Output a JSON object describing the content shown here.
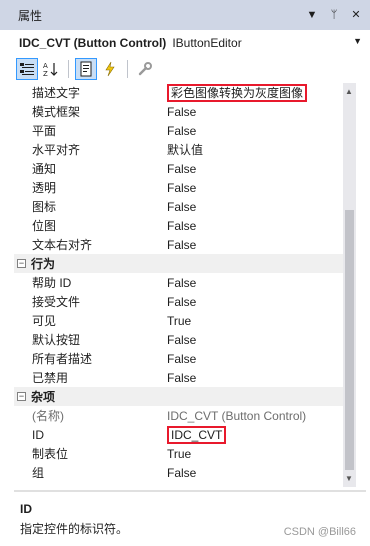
{
  "window": {
    "title": "属性",
    "buttons": [
      "▼",
      "ᛘ",
      "✕"
    ]
  },
  "object_selector": {
    "name": "IDC_CVT (Button Control)",
    "type": "IButtonEditor"
  },
  "rows": [
    {
      "kind": "prop",
      "name": "描述文字",
      "value": "彩色图像转换为灰度图像",
      "highlight": true
    },
    {
      "kind": "prop",
      "name": "模式框架",
      "value": "False"
    },
    {
      "kind": "prop",
      "name": "平面",
      "value": "False"
    },
    {
      "kind": "prop",
      "name": "水平对齐",
      "value": "默认值"
    },
    {
      "kind": "prop",
      "name": "通知",
      "value": "False"
    },
    {
      "kind": "prop",
      "name": "透明",
      "value": "False"
    },
    {
      "kind": "prop",
      "name": "图标",
      "value": "False"
    },
    {
      "kind": "prop",
      "name": "位图",
      "value": "False"
    },
    {
      "kind": "prop",
      "name": "文本右对齐",
      "value": "False"
    },
    {
      "kind": "cat",
      "name": "行为",
      "toggle": "−"
    },
    {
      "kind": "prop",
      "name": "帮助 ID",
      "value": "False"
    },
    {
      "kind": "prop",
      "name": "接受文件",
      "value": "False"
    },
    {
      "kind": "prop",
      "name": "可见",
      "value": "True"
    },
    {
      "kind": "prop",
      "name": "默认按钮",
      "value": "False"
    },
    {
      "kind": "prop",
      "name": "所有者描述",
      "value": "False"
    },
    {
      "kind": "prop",
      "name": "已禁用",
      "value": "False"
    },
    {
      "kind": "cat",
      "name": "杂项",
      "toggle": "−"
    },
    {
      "kind": "prop",
      "name": "(名称)",
      "value": "IDC_CVT (Button Control)",
      "grey": true
    },
    {
      "kind": "prop",
      "name": "ID",
      "value": "IDC_CVT",
      "highlight": true
    },
    {
      "kind": "prop",
      "name": "制表位",
      "value": "True"
    },
    {
      "kind": "prop",
      "name": "组",
      "value": "False"
    }
  ],
  "description": {
    "title": "ID",
    "text": "指定控件的标识符。"
  },
  "watermark": "CSDN @Bill66",
  "colors": {
    "titlebar": "#cfd6e5",
    "highlight_border": "#e8192c",
    "active_tool": "#c9def5"
  }
}
